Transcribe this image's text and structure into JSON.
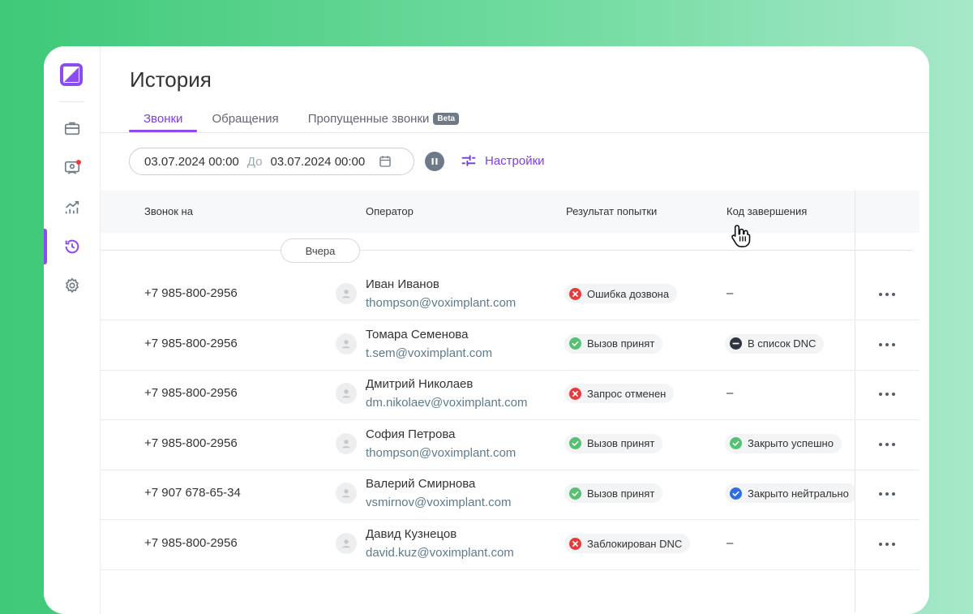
{
  "page": {
    "title": "История",
    "tabs": [
      {
        "label": "Звонки",
        "active": true
      },
      {
        "label": "Обращения",
        "active": false
      },
      {
        "label": "Пропущенные звонки",
        "badge": "Beta",
        "active": false
      }
    ]
  },
  "filters": {
    "date_from": "03.07.2024 00:00",
    "separator": "До",
    "date_to": "03.07.2024 00:00",
    "settings_label": "Настройки"
  },
  "sidebar": {
    "items": [
      {
        "icon": "briefcase-icon",
        "active": false
      },
      {
        "icon": "agent-icon",
        "active": false,
        "notification": true
      },
      {
        "icon": "analytics-icon",
        "active": false
      },
      {
        "icon": "history-icon",
        "active": true
      },
      {
        "icon": "gear-icon",
        "active": false
      }
    ]
  },
  "table": {
    "headers": [
      "Звонок на",
      "Оператор",
      "Результат попытки",
      "Код завершения"
    ],
    "group_label": "Вчера",
    "rows": [
      {
        "phone": "+7 985-800-2956",
        "name": "Иван Иванов",
        "email": "thompson@voximplant.com",
        "result": "Ошибка дозвона",
        "result_status": "error",
        "code": "–",
        "code_status": "none"
      },
      {
        "phone": "+7 985-800-2956",
        "name": "Томара Семенова",
        "email": "t.sem@voximplant.com",
        "result": "Вызов принят",
        "result_status": "success",
        "code": "В список DNC",
        "code_status": "dnc"
      },
      {
        "phone": "+7 985-800-2956",
        "name": "Дмитрий Николаев",
        "email": "dm.nikolaev@voximplant.com",
        "result": "Запрос отменен",
        "result_status": "error",
        "code": "–",
        "code_status": "none"
      },
      {
        "phone": "+7 985-800-2956",
        "name": "София Петрова",
        "email": "thompson@voximplant.com",
        "result": "Вызов принят",
        "result_status": "success",
        "code": "Закрыто успешно",
        "code_status": "success"
      },
      {
        "phone": "+7 907 678-65-34",
        "name": "Валерий Смирнова",
        "email": "vsmirnov@voximplant.com",
        "result": "Вызов принят",
        "result_status": "success",
        "code": "Закрыто нейтрально",
        "code_status": "neutral"
      },
      {
        "phone": "+7 985-800-2956",
        "name": "Давид Кузнецов",
        "email": "david.kuz@voximplant.com",
        "result": "Заблокирован DNC",
        "result_status": "error",
        "code": "–",
        "code_status": "none"
      }
    ]
  },
  "colors": {
    "accent": "#8b4cf0",
    "success": "#56c271",
    "error": "#ea3b3b",
    "neutral": "#2f6fe3",
    "dnc": "#2f3540"
  }
}
